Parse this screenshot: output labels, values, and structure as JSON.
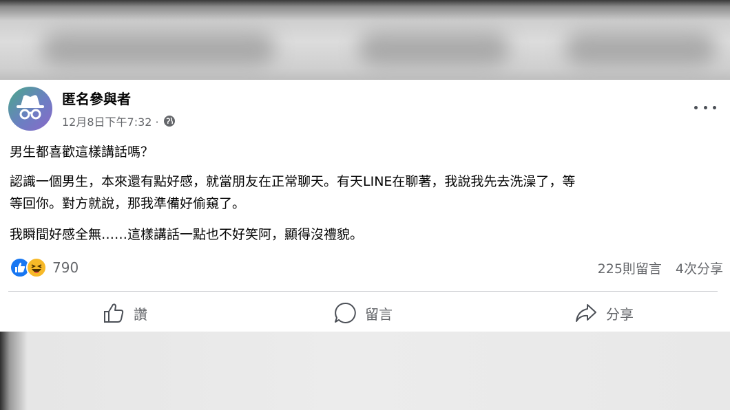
{
  "post": {
    "author": "匿名參與者",
    "timestamp": "12月8日下午7:32 ·",
    "privacy_icon": "globe-icon",
    "title": "男生都喜歡這樣講話嗎？",
    "body_line1": "認識一個男生，本來還有點好感，就當朋友在正常聊天。有天LINE在聊著，我說我先去洗澡了，等",
    "body_line2": "等回你。對方就說，那我準備好偷窺了。",
    "body_paragraph2": "我瞬間好感全無……這樣講話一點也不好笑阿，顯得沒禮貌。",
    "reaction_count": "790",
    "reaction_icons": [
      "like-icon",
      "haha-icon"
    ],
    "comments": "225則留言",
    "shares": "4次分享"
  },
  "actions": {
    "like_label": "讚",
    "comment_label": "留言",
    "share_label": "分享"
  },
  "colors": {
    "like_blue": "#1877f2",
    "haha_yellow": "#f7b928",
    "secondary_text": "#65676b"
  }
}
